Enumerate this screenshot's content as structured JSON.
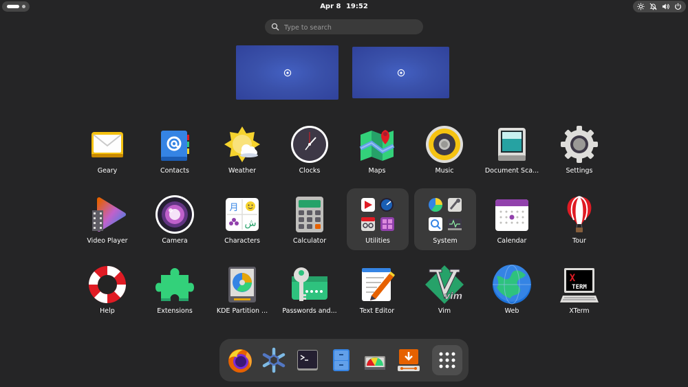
{
  "topbar": {
    "date": "Apr 8",
    "time": "19:52"
  },
  "search": {
    "placeholder": "Type to search"
  },
  "apps": [
    {
      "label": "Geary",
      "icon": "geary-icon"
    },
    {
      "label": "Contacts",
      "icon": "contacts-icon"
    },
    {
      "label": "Weather",
      "icon": "weather-icon"
    },
    {
      "label": "Clocks",
      "icon": "clocks-icon"
    },
    {
      "label": "Maps",
      "icon": "maps-icon"
    },
    {
      "label": "Music",
      "icon": "music-icon"
    },
    {
      "label": "Document Sca...",
      "icon": "document-scanner-icon"
    },
    {
      "label": "Settings",
      "icon": "settings-icon"
    },
    {
      "label": "Video Player",
      "icon": "video-player-icon"
    },
    {
      "label": "Camera",
      "icon": "camera-icon"
    },
    {
      "label": "Characters",
      "icon": "characters-icon"
    },
    {
      "label": "Calculator",
      "icon": "calculator-icon"
    },
    {
      "label": "Utilities",
      "icon": "utilities-folder-icon"
    },
    {
      "label": "System",
      "icon": "system-folder-icon"
    },
    {
      "label": "Calendar",
      "icon": "calendar-icon"
    },
    {
      "label": "Tour",
      "icon": "tour-icon"
    },
    {
      "label": "Help",
      "icon": "help-icon"
    },
    {
      "label": "Extensions",
      "icon": "extensions-icon"
    },
    {
      "label": "KDE Partition ...",
      "icon": "kde-partition-manager-icon"
    },
    {
      "label": "Passwords and...",
      "icon": "passwords-and-keys-icon"
    },
    {
      "label": "Text Editor",
      "icon": "text-editor-icon"
    },
    {
      "label": "Vim",
      "icon": "vim-icon"
    },
    {
      "label": "Web",
      "icon": "web-browser-icon"
    },
    {
      "label": "XTerm",
      "icon": "xterm-icon"
    }
  ],
  "characters_icon_glyphs": [
    "月",
    "ش"
  ],
  "xterm_icon_text": [
    "X",
    "TERM"
  ],
  "vim_icon_text": "vim",
  "colors": {
    "background": "#252526",
    "panel": "#3a3a3a",
    "workspace": "#3a51aa",
    "accent_blue": "#3584e4"
  }
}
